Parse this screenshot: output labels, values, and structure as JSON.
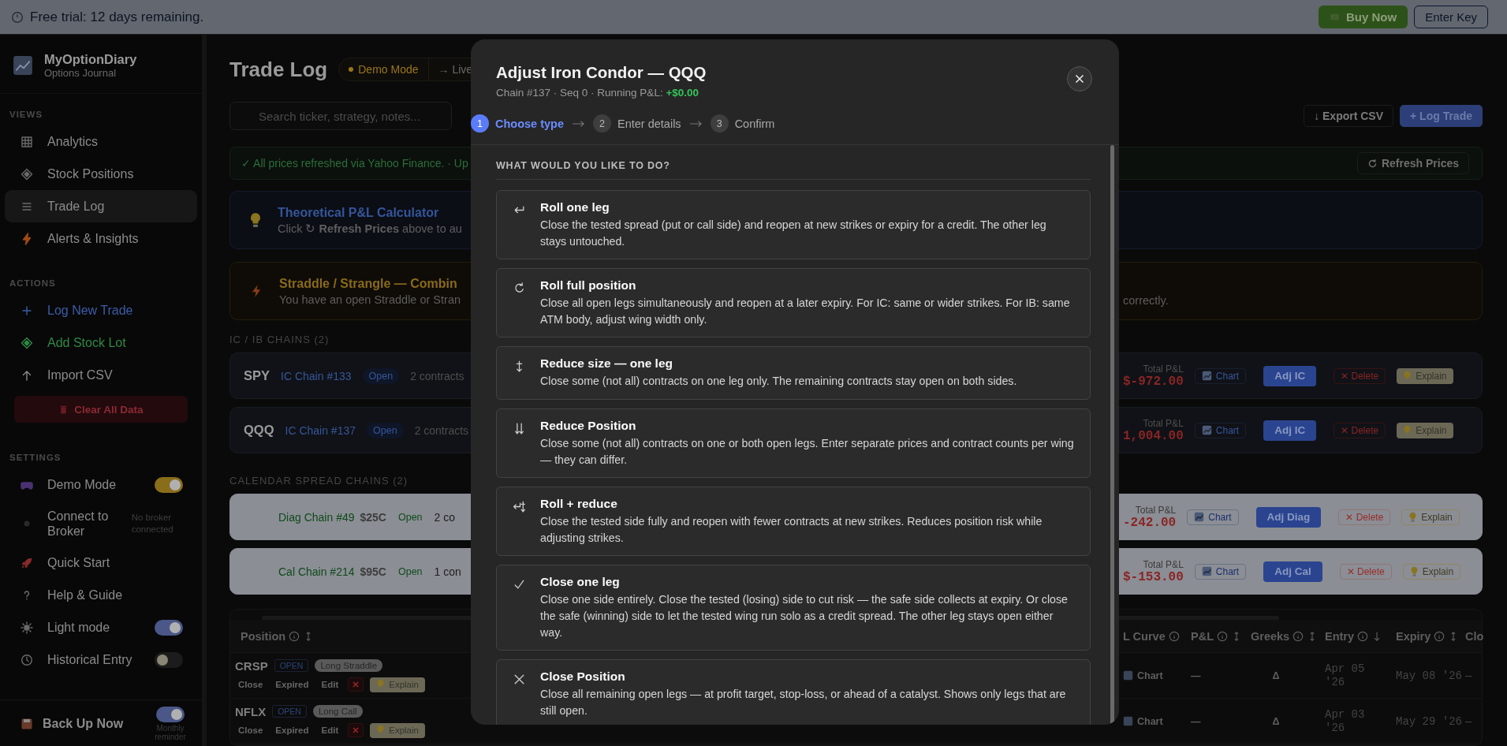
{
  "trial_banner": {
    "text": "Free trial: 12 days remaining.",
    "buttons": [
      {
        "label": "Buy Now",
        "kind": "primary"
      },
      {
        "label": "Enter Key",
        "kind": "outline"
      }
    ]
  },
  "sidebar": {
    "app_name": "MyOptionDiary",
    "app_subtitle": "Options Journal",
    "views": {
      "title": "VIEWS",
      "items": [
        {
          "label": "Analytics",
          "selected": false
        },
        {
          "label": "Stock Positions",
          "selected": false
        },
        {
          "label": "Trade Log",
          "selected": true
        },
        {
          "label": "Alerts & Insights",
          "selected": false
        }
      ]
    },
    "actions": {
      "title": "ACTIONS",
      "items": [
        {
          "label": "Log New Trade",
          "color": "#3d5ca8"
        },
        {
          "label": "Add Stock Lot",
          "color": "#2f8a46"
        },
        {
          "label": "Import CSV",
          "color": "#8b8b8b"
        }
      ],
      "clear_button": "Clear All Data"
    },
    "settings": {
      "title": "SETTINGS",
      "items": [
        {
          "kind": "toggle",
          "label": "Demo Mode",
          "on": true,
          "color": "#8a6d1a"
        },
        {
          "kind": "status",
          "label": "Connect to Broker",
          "note": "No broker connected"
        },
        {
          "kind": "link",
          "label": "Quick Start"
        },
        {
          "kind": "link",
          "label": "Help & Guide"
        },
        {
          "kind": "toggle",
          "label": "Light mode",
          "on": true,
          "color": "#4a5788"
        },
        {
          "kind": "toggle",
          "label": "Historical Entry",
          "on": false
        }
      ]
    },
    "backup": {
      "label": "Back Up Now",
      "reminder_on": true,
      "note": "Monthly reminder"
    }
  },
  "main": {
    "title": "Trade Log",
    "mode_pills": [
      {
        "label": "Demo Mode",
        "selected": true
      },
      {
        "label": "→ Live",
        "selected": false
      }
    ],
    "search": {
      "placeholder": "Search ticker, strategy, notes..."
    },
    "toolbar_buttons": [
      {
        "label": "↓ Export CSV",
        "kind": "outline"
      },
      {
        "label": "+ Log Trade",
        "kind": "primary"
      }
    ],
    "status_bar": {
      "text": "✓ All prices refreshed via Yahoo Finance. · Up",
      "button": "Refresh Prices"
    },
    "notices": [
      {
        "kind": "info",
        "title": "Theoretical P&L Calculator",
        "text": "Click ↻ **Refresh Prices** above to au"
      },
      {
        "kind": "warning",
        "title": "Straddle / Strangle — Combin",
        "text": "You have an open Straddle or Stran",
        "tail": "correctly."
      }
    ],
    "chain_groups": [
      {
        "title": "IC / IB CHAINS (2)",
        "kind": "dark",
        "chains": [
          {
            "ticker": "SPY",
            "name": "IC Chain #133",
            "status": "Open",
            "contracts": "2 contracts",
            "pnl_label": "Total P&L",
            "pnl": "$-972.00",
            "chart": "Chart",
            "adjust": "Adj IC",
            "delete": "✕ Delete",
            "explain": "Explain"
          },
          {
            "ticker": "QQQ",
            "name": "IC Chain #137",
            "status": "Open",
            "contracts": "2 contracts",
            "pnl_label": "Total P&L",
            "pnl": "1,004.00",
            "chart": "Chart",
            "adjust": "Adj IC",
            "delete": "✕ Delete",
            "explain": "Explain"
          }
        ]
      },
      {
        "title": "CALENDAR SPREAD CHAINS (2)",
        "kind": "light",
        "chains": [
          {
            "name": "Diag Chain #49",
            "strike": "$25C",
            "status": "Open",
            "contracts": "2 co",
            "pnl_label": "Total P&L",
            "pnl": "-242.00",
            "chart": "Chart",
            "adjust": "Adj Diag",
            "delete": "✕ Delete",
            "explain": "Explain"
          },
          {
            "name": "Cal Chain #214",
            "strike": "$95C",
            "status": "Open",
            "contracts": "1 con",
            "pnl_label": "Total P&L",
            "pnl": "$-153.00",
            "chart": "Chart",
            "adjust": "Adj Cal",
            "delete": "✕ Delete",
            "explain": "Explain"
          }
        ]
      }
    ],
    "table": {
      "left_columns": [
        {
          "label": "Position",
          "info": true,
          "sortable": true,
          "sorted": false
        }
      ],
      "right_columns": [
        {
          "label": "L Curve",
          "info": true,
          "sortable": false,
          "sorted": false
        },
        {
          "label": "P&L",
          "info": true,
          "sortable": true,
          "sorted": false
        },
        {
          "label": "Greeks",
          "info": true,
          "sortable": true,
          "sorted": false
        },
        {
          "label": "Entry",
          "info": true,
          "sortable": true,
          "sorted": true
        },
        {
          "label": "Expiry",
          "info": true,
          "sortable": true,
          "sorted": false
        },
        {
          "label": "Clo"
        }
      ],
      "rows": [
        {
          "ticker": "CRSP",
          "status": "OPEN",
          "strategy": "Long Straddle",
          "actions": [
            "Close",
            "Expired",
            "Edit"
          ],
          "explain": "Explain",
          "chart": "Chart",
          "pnl": "—",
          "greeks": "Δ",
          "entry": "Apr 05 '26",
          "expiry": "May 08 '26",
          "close": "—"
        },
        {
          "ticker": "NFLX",
          "status": "OPEN",
          "strategy": "Long Call",
          "actions": [
            "Close",
            "Expired",
            "Edit"
          ],
          "explain": "Explain",
          "chart": "Chart",
          "pnl": "—",
          "greeks": "Δ",
          "entry": "Apr 03 '26",
          "expiry": "May 29 '26",
          "close": "—"
        }
      ]
    }
  },
  "modal": {
    "title": "Adjust Iron Condor — QQQ",
    "subtitle": "Chain #137 · Seq 0 · Running P&L:",
    "running_pnl": "+$0.00",
    "steps": [
      {
        "number": "1",
        "label": "Choose type",
        "selected": true
      },
      {
        "number": "2",
        "label": "Enter details",
        "selected": false
      },
      {
        "number": "3",
        "label": "Confirm",
        "selected": false
      }
    ],
    "section_title": "WHAT WOULD YOU LIKE TO DO?",
    "options": [
      {
        "kind": "roll-leg",
        "title": "Roll one leg",
        "description": "Close the tested spread (put or call side) and reopen at new strikes or expiry for a credit. The other leg stays untouched."
      },
      {
        "kind": "roll-full",
        "title": "Roll full position",
        "description": "Close all open legs simultaneously and reopen at a later expiry. For IC: same or wider strikes. For IB: same ATM body, adjust wing width only."
      },
      {
        "kind": "reduce-leg",
        "title": "Reduce size — one leg",
        "description": "Close some (not all) contracts on one leg only. The remaining contracts stay open on both sides."
      },
      {
        "kind": "reduce-position",
        "title": "Reduce Position",
        "description": "Close some (not all) contracts on one or both open legs. Enter separate prices and contract counts per wing — they can differ."
      },
      {
        "kind": "roll-reduce",
        "title": "Roll + reduce",
        "description": "Close the tested side fully and reopen with fewer contracts at new strikes. Reduces position risk while adjusting strikes."
      },
      {
        "kind": "close-leg",
        "title": "Close one leg",
        "description": "Close one side entirely. Close the tested (losing) side to cut risk — the safe side collects at expiry. Or close the safe (winning) side to let the tested wing run solo as a credit spread. The other leg stays open either way."
      },
      {
        "kind": "close-position",
        "title": "Close Position",
        "description": "Close all remaining open legs — at profit target, stop-loss, or ahead of a catalyst. Shows only legs that are still open."
      }
    ]
  }
}
